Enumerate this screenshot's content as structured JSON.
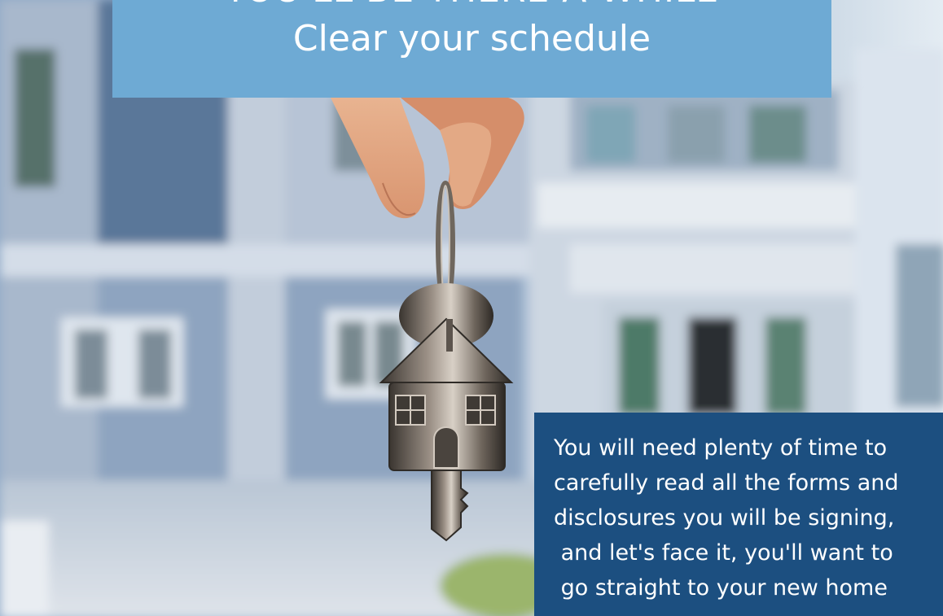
{
  "colors": {
    "title_card_bg": "#6eaad4",
    "info_card_bg": "#1c4f80",
    "text": "#ffffff"
  },
  "title_card": {
    "line1": "YOU'LL BE THERE A WHILE",
    "line2": "Clear your schedule"
  },
  "info_card": {
    "text": "You will need plenty of time to\ncarefully read all the forms and\ndisclosures you will be signing,\n and let's face it, you'll want to\n go straight to your new home"
  },
  "photo": {
    "subject": "hand holding house-shaped key in front of blurred house"
  }
}
